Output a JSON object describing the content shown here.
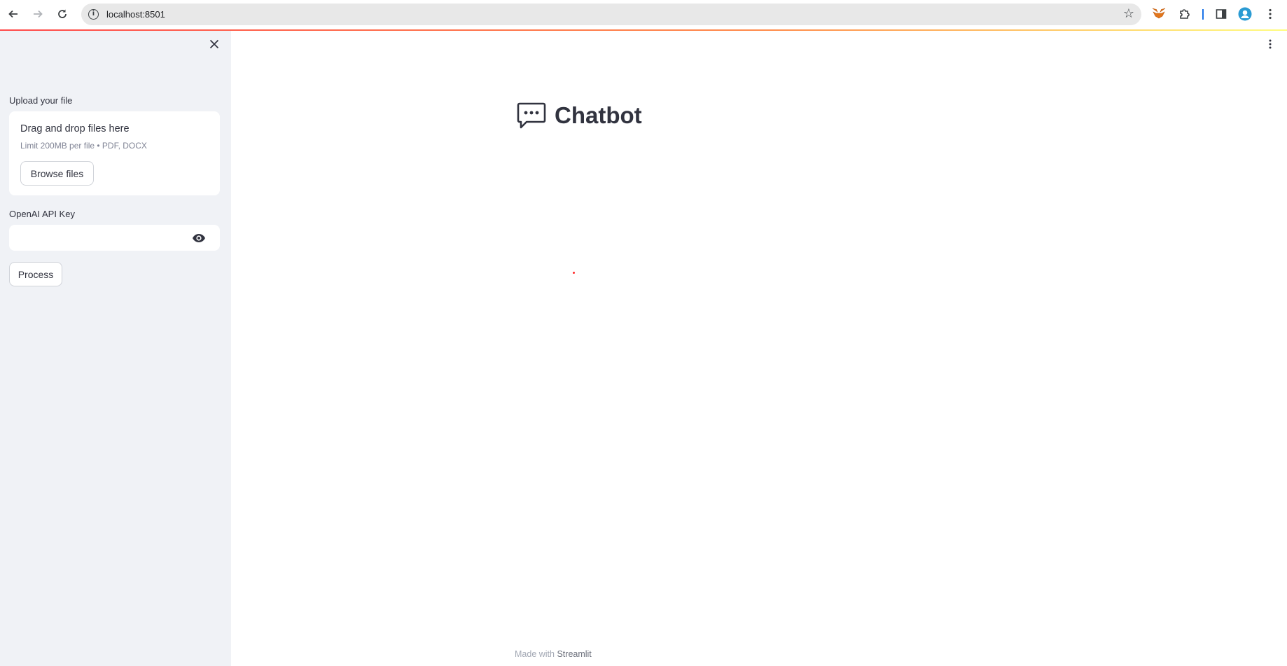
{
  "browser": {
    "url": "localhost:8501"
  },
  "sidebar": {
    "upload_label": "Upload your file",
    "dropzone_title": "Drag and drop files here",
    "dropzone_limit": "Limit 200MB per file • PDF, DOCX",
    "browse_label": "Browse files",
    "api_key_label": "OpenAI API Key",
    "api_key_value": "",
    "process_label": "Process"
  },
  "main": {
    "title": "Chatbot",
    "footer_prefix": "Made with",
    "footer_brand": "Streamlit"
  },
  "colors": {
    "accent": "#ff4b4b",
    "sidebar_bg": "#f0f2f6",
    "text": "#31333f"
  }
}
